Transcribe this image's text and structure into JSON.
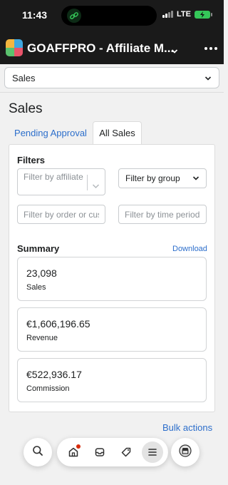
{
  "status_bar": {
    "time": "11:43",
    "network": "LTE"
  },
  "app": {
    "title": "GOAFFPRO - Affiliate M..."
  },
  "page_select": {
    "value": "Sales"
  },
  "page": {
    "title": "Sales"
  },
  "tabs": [
    {
      "label": "Pending Approval"
    },
    {
      "label": "All Sales"
    }
  ],
  "filters": {
    "title": "Filters",
    "affiliate_placeholder": "Filter by affiliate",
    "group_label": "Filter by group",
    "order_placeholder": "Filter by order or customer",
    "time_placeholder": "Filter by time period"
  },
  "summary": {
    "title": "Summary",
    "download_label": "Download",
    "metrics": [
      {
        "value": "23,098",
        "label": "Sales"
      },
      {
        "value": "€1,606,196.65",
        "label": "Revenue"
      },
      {
        "value": "€522,936.17",
        "label": "Commission"
      }
    ]
  },
  "bulk_actions_label": "Bulk actions",
  "nav": {
    "icons": [
      "search-icon",
      "home-icon",
      "inbox-icon",
      "tag-icon",
      "menu-icon",
      "store-icon"
    ]
  }
}
